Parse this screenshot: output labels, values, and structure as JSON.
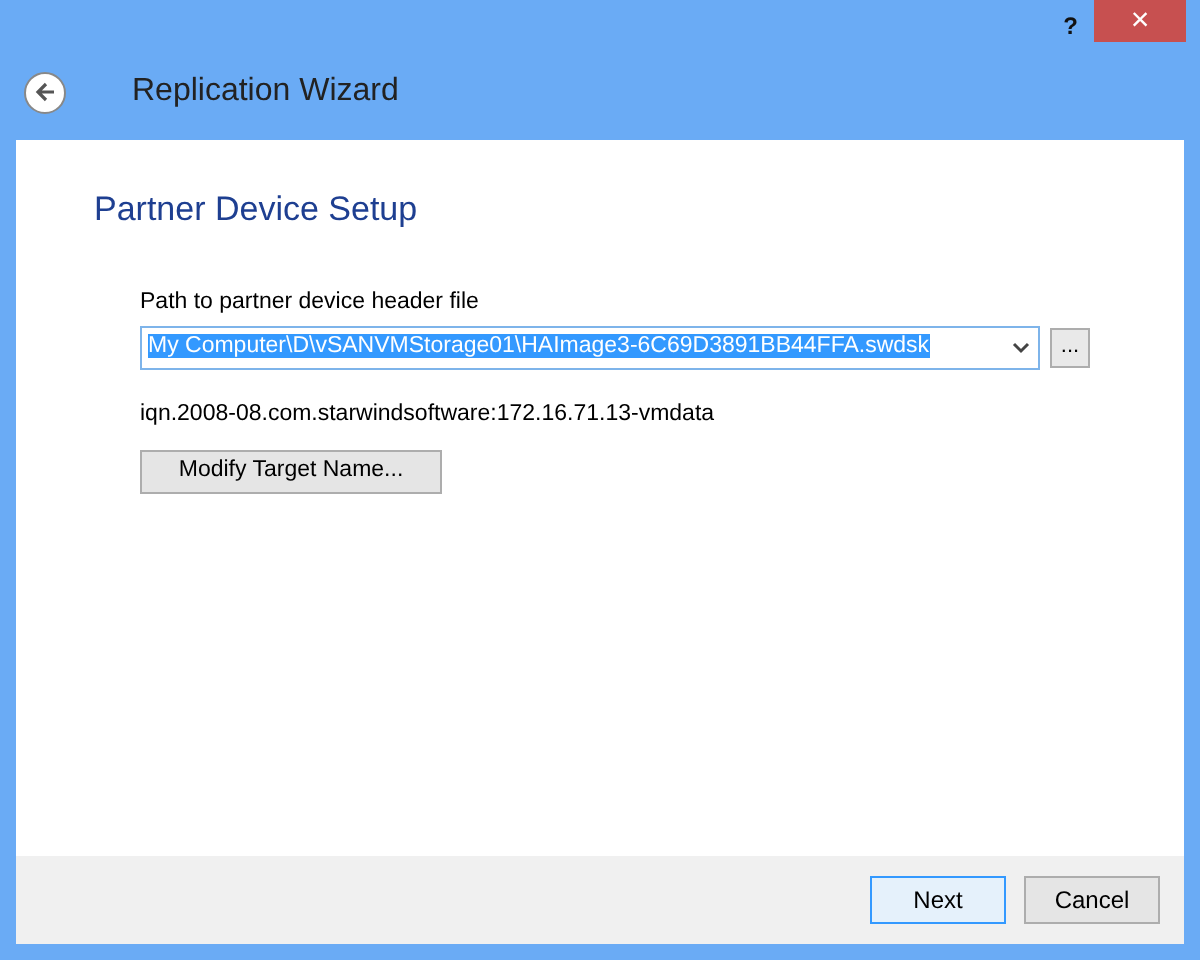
{
  "window": {
    "help": "?",
    "close": "×"
  },
  "header": {
    "title": "Replication Wizard"
  },
  "page": {
    "heading": "Partner Device Setup",
    "path_field": {
      "label": "Path to partner device header file",
      "value": "My Computer\\D\\vSANVMStorage01\\HAImage3-6C69D3891BB44FFA.swdsk",
      "selected": true
    },
    "browse_button": "...",
    "target_name": "iqn.2008-08.com.starwindsoftware:172.16.71.13-vmdata",
    "modify_button": "Modify Target Name..."
  },
  "footer": {
    "buttons": [
      {
        "label": "Next",
        "default": true
      },
      {
        "label": "Cancel",
        "default": false
      }
    ]
  }
}
